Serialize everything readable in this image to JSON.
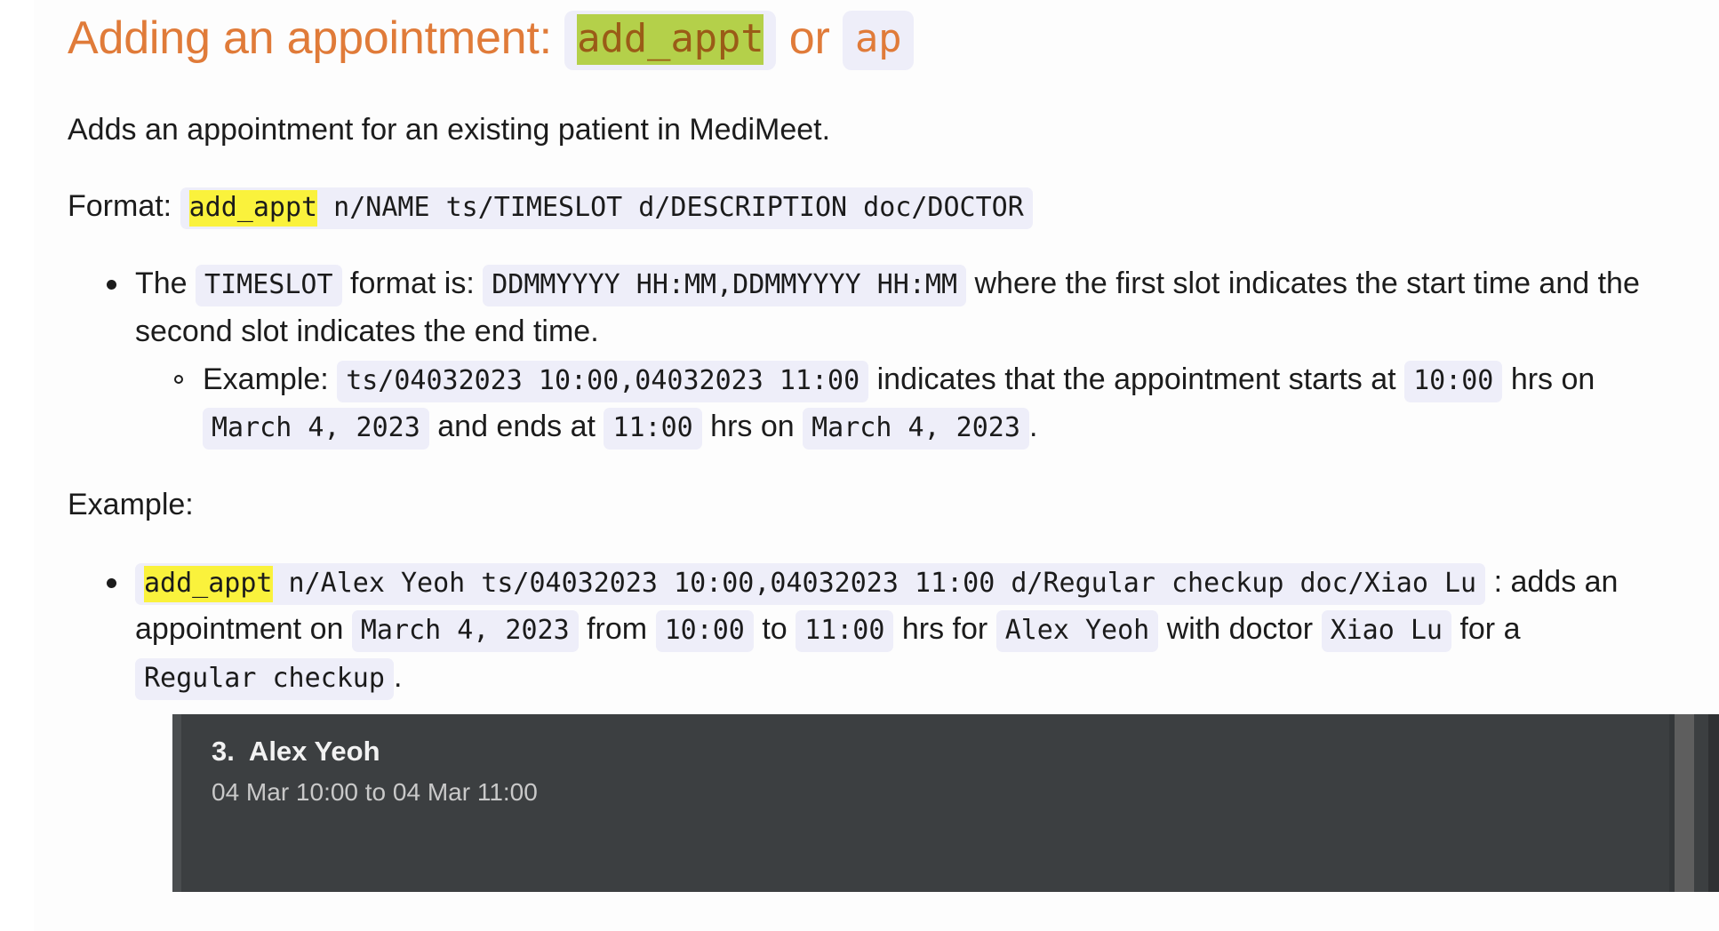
{
  "heading": {
    "prefix": "Adding an appointment: ",
    "command_full": "add_appt",
    "conjunction": " or ",
    "command_short": "ap"
  },
  "intro": "Adds an appointment for an existing patient in MediMeet.",
  "format": {
    "label": "Format: ",
    "command": "add_appt",
    "rest": " n/NAME ts/TIMESLOT d/DESCRIPTION doc/DOCTOR"
  },
  "bullets": {
    "timeslot": {
      "text_1": "The ",
      "code_1": "TIMESLOT",
      "text_2": " format is: ",
      "code_2": "DDMMYYYY HH:MM,DDMMYYYY HH:MM",
      "text_3": " where the first slot indicates the start time and the second slot indicates the end time."
    },
    "timeslot_example": {
      "text_1": "Example: ",
      "code_1": "ts/04032023 10:00,04032023 11:00",
      "text_2": " indicates that the appointment starts at ",
      "code_2": "10:00",
      "text_3": " hrs on ",
      "code_3": "March 4, 2023",
      "text_4": " and ends at ",
      "code_4": "11:00",
      "text_5": " hrs on ",
      "code_5": "March 4, 2023",
      "text_6": "."
    }
  },
  "example_label": "Example:",
  "example_bullet": {
    "cmd_highlight": "add_appt",
    "cmd_rest": " n/Alex Yeoh ts/04032023 10:00,04032023 11:00 d/Regular checkup doc/Xiao Lu",
    "text_1": " : adds an appointment on ",
    "code_date": "March 4, 2023",
    "text_2": " from ",
    "code_start": "10:00",
    "text_3": " to ",
    "code_end": "11:00",
    "text_4": " hrs for ",
    "code_patient": "Alex Yeoh",
    "text_5": " with doctor ",
    "code_doctor": "Xiao Lu",
    "text_6": " for a ",
    "code_desc": "Regular checkup",
    "text_7": "."
  },
  "screenshot": {
    "entry_title": "3.  Alex Yeoh",
    "entry_subtitle": "04 Mar 10:00 to 04 Mar 11:00"
  },
  "colors": {
    "heading": "#e07b39",
    "code_bg": "#eeeef9",
    "highlight_green": "#b4d04a",
    "highlight_yellow": "#faf23c",
    "panel_bg": "#3c3f41",
    "page_bg": "#fdfdfd"
  }
}
